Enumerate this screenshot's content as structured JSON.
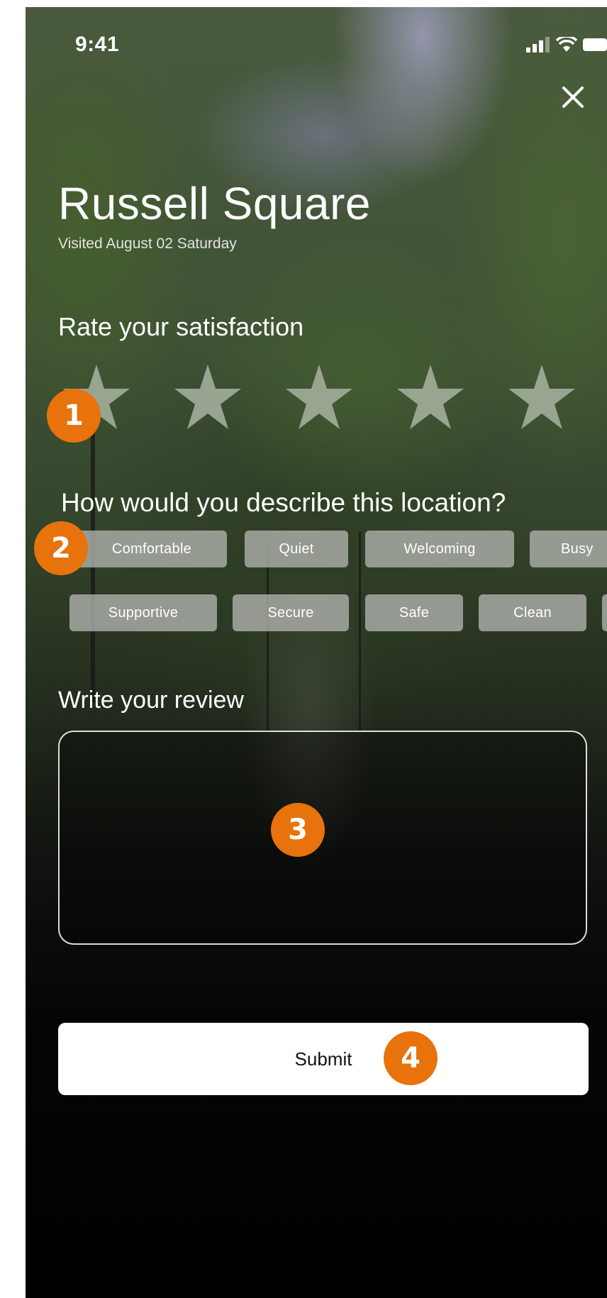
{
  "status_bar": {
    "time": "9:41",
    "icons": [
      "signal-icon",
      "wifi-icon",
      "battery-icon"
    ]
  },
  "header": {
    "close_icon": "close-icon",
    "title": "Russell Square",
    "subtitle": "Visited August 02 Saturday"
  },
  "rating": {
    "label": "Rate your satisfaction",
    "max_stars": 5,
    "selected": 0,
    "star_color": "#a9b3a2"
  },
  "describe": {
    "label": "How would you describe this location?",
    "row1": [
      "Comfortable",
      "Quiet",
      "Welcoming",
      "Busy"
    ],
    "row2": [
      "Supportive",
      "Secure",
      "Safe",
      "Clean"
    ]
  },
  "review": {
    "label": "Write your review",
    "value": ""
  },
  "submit": {
    "label": "Submit"
  },
  "annotations": {
    "color": "#e8720c",
    "markers": [
      "1",
      "2",
      "3",
      "4"
    ]
  }
}
